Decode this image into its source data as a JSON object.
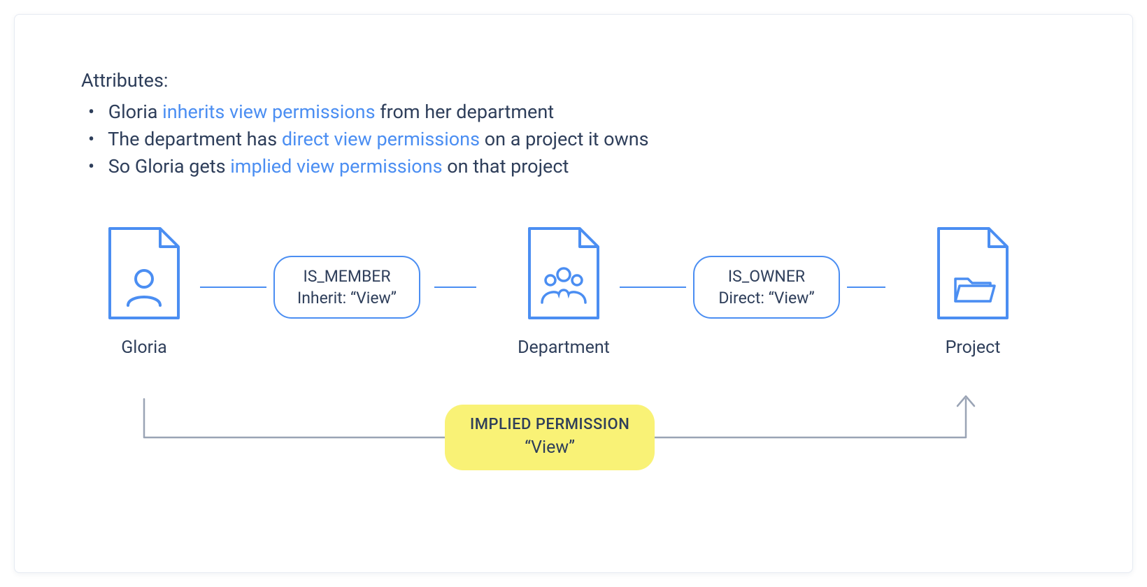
{
  "attributes": {
    "title": "Attributes:",
    "items": [
      {
        "pre": "Gloria ",
        "hl": "inherits view permissions",
        "post": " from her department"
      },
      {
        "pre": "The department has ",
        "hl": "direct view permissions",
        "post": " on a project it owns"
      },
      {
        "pre": "So Gloria gets ",
        "hl": "implied view permissions",
        "post": " on that project"
      }
    ]
  },
  "nodes": {
    "gloria": {
      "label": "Gloria",
      "icon": "person-icon"
    },
    "department": {
      "label": "Department",
      "icon": "group-icon"
    },
    "project": {
      "label": "Project",
      "icon": "folder-icon"
    }
  },
  "relations": {
    "member": {
      "line1": "IS_MEMBER",
      "line2": "Inherit: “View”"
    },
    "owner": {
      "line1": "IS_OWNER",
      "line2": "Direct: “View”"
    }
  },
  "implied": {
    "line1": "IMPLIED PERMISSION",
    "line2": "“View”"
  },
  "colors": {
    "stroke": "#4b8ef2",
    "text": "#2e3e5a",
    "highlight": "#f9f276",
    "connector": "#9aa4b5"
  }
}
